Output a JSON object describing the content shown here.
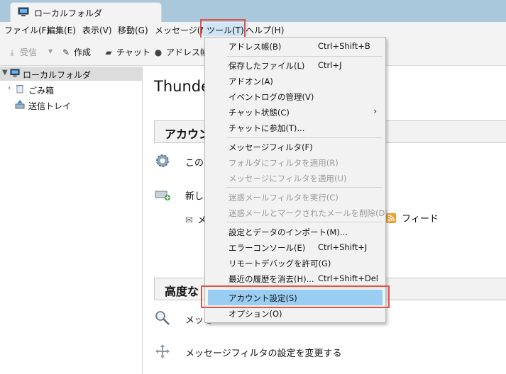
{
  "tab": {
    "title": "ローカルフォルダ"
  },
  "menubar": {
    "items": [
      "ファイル(F)",
      "編集(E)",
      "表示(V)",
      "移動(G)",
      "メッセージ(M)",
      "ツール(T)",
      "ヘルプ(H)"
    ]
  },
  "toolbar": {
    "receive": "受信",
    "compose": "作成",
    "chat": "チャット",
    "address_book": "アドレス帳"
  },
  "folders": {
    "root": "ローカルフォルダ",
    "trash": "ごみ箱",
    "outbox": "送信トレイ"
  },
  "main": {
    "heading": "Thunde",
    "accounts_section": "アカウン",
    "row1_text": "このア",
    "row2_text": "新し",
    "row3_prefix": "メ",
    "feed_label": "フィード",
    "advanced_section": "高度な",
    "row4_text": "メッセ",
    "row5_text": "メッセージフィルタの設定を変更する"
  },
  "tools_menu": {
    "items": [
      {
        "label": "アドレス帳(B)",
        "shortcut": "Ctrl+Shift+B",
        "disabled": false
      },
      {
        "label": "保存したファイル(L)",
        "shortcut": "Ctrl+J",
        "disabled": false
      },
      {
        "label": "アドオン(A)",
        "shortcut": "",
        "disabled": false
      },
      {
        "label": "イベントログの管理(V)",
        "shortcut": "",
        "disabled": false
      },
      {
        "label": "チャット状態(C)",
        "shortcut": "",
        "submenu": "›",
        "disabled": false
      },
      {
        "label": "チャットに参加(T)...",
        "shortcut": "",
        "disabled": false
      },
      {
        "label": "メッセージフィルタ(F)",
        "shortcut": "",
        "disabled": false
      },
      {
        "label": "フォルダにフィルタを適用(R)",
        "shortcut": "",
        "disabled": true
      },
      {
        "label": "メッセージにフィルタを適用(U)",
        "shortcut": "",
        "disabled": true
      },
      {
        "label": "迷惑メールフィルタを実行(C)",
        "shortcut": "",
        "disabled": true
      },
      {
        "label": "迷惑メールとマークされたメールを削除(D)",
        "shortcut": "",
        "disabled": true
      },
      {
        "label": "設定とデータのインポート(M)...",
        "shortcut": "",
        "disabled": false
      },
      {
        "label": "エラーコンソール(E)",
        "shortcut": "Ctrl+Shift+J",
        "disabled": false
      },
      {
        "label": "リモートデバッグを許可(G)",
        "shortcut": "",
        "disabled": false
      },
      {
        "label": "最近の履歴を消去(H)...",
        "shortcut": "Ctrl+Shift+Del",
        "disabled": false
      },
      {
        "label": "アカウント設定(S)",
        "shortcut": "",
        "disabled": false,
        "highlighted": true
      },
      {
        "label": "オプション(O)",
        "shortcut": "",
        "disabled": false
      }
    ]
  },
  "colors": {
    "highlight": "#99cdf2",
    "annotation_red": "#e0544a",
    "tabbar": "#a9c8dc"
  }
}
